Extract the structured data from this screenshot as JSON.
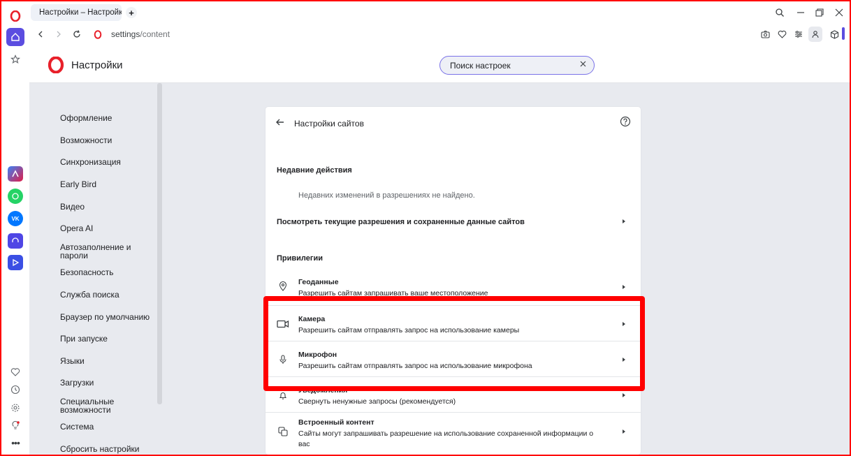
{
  "browser": {
    "tab_title": "Настройки – Настройки са",
    "new_tab": "+",
    "url_host": "settings",
    "url_path": "/content"
  },
  "header": {
    "brand": "Настройки",
    "search_value": "Поиск настроек"
  },
  "nav": {
    "items": [
      "Оформление",
      "Возможности",
      "Синхронизация",
      "Early Bird",
      "Видео",
      "Opera AI",
      "Автозаполнение и пароли",
      "Безопасность",
      "Служба поиска",
      "Браузер по умолчанию",
      "При запуске",
      "Языки",
      "Загрузки",
      "Специальные возможности",
      "Система",
      "Сбросить настройки"
    ]
  },
  "card": {
    "title": "Настройки сайтов",
    "recent_heading": "Недавние действия",
    "recent_empty": "Недавних изменений в разрешениях не найдено.",
    "view_permissions": "Посмотреть текущие разрешения и сохраненные данные сайтов",
    "privileges_heading": "Привилегии",
    "permissions": [
      {
        "title": "Геоданные",
        "subtitle": "Разрешить сайтам запрашивать ваше местоположение",
        "icon": "location-pin-icon"
      },
      {
        "title": "Камера",
        "subtitle": "Разрешить сайтам отправлять запрос на использование камеры",
        "icon": "video-camera-icon"
      },
      {
        "title": "Микрофон",
        "subtitle": "Разрешить сайтам отправлять запрос на использование микрофона",
        "icon": "microphone-icon"
      },
      {
        "title": "Уведомления",
        "subtitle": "Свернуть ненужные запросы (рекомендуется)",
        "icon": "bell-icon"
      },
      {
        "title": "Встроенный контент",
        "subtitle": "Сайты могут запрашивать разрешение на использование сохраненной информации о",
        "subtitle2": "вас",
        "icon": "embedded-content-icon"
      }
    ]
  },
  "colors": {
    "accent": "#5b4de0",
    "highlight": "#ff0000",
    "opera_red": "#e8202a"
  }
}
